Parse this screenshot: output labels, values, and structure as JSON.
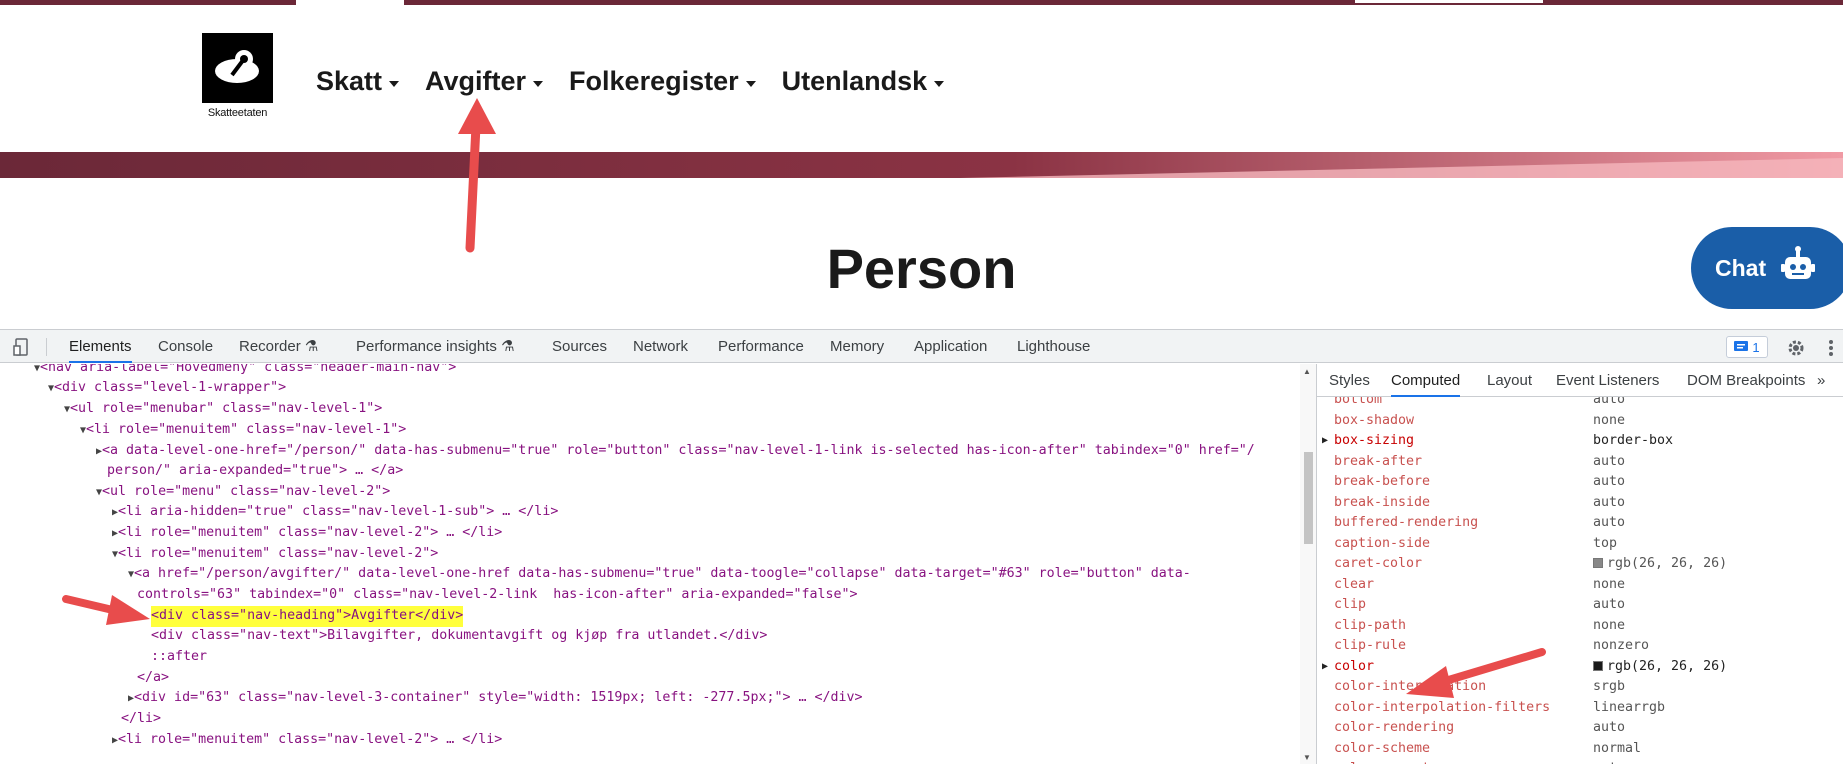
{
  "site": {
    "logo_text": "Skatteetaten",
    "nav": [
      "Skatt",
      "Avgifter",
      "Folkeregister",
      "Utenlandsk"
    ],
    "page_title": "Person",
    "chat_label": "Chat",
    "colors": {
      "brand_bar": "#6b2838",
      "chat": "#1a5ea8"
    }
  },
  "devtools": {
    "tabs": [
      "Elements",
      "Console",
      "Recorder",
      "Performance insights",
      "Sources",
      "Network",
      "Performance",
      "Memory",
      "Application",
      "Lighthouse"
    ],
    "active_tab": "Elements",
    "issues_count": "1",
    "side_tabs": [
      "Styles",
      "Computed",
      "Layout",
      "Event Listeners",
      "DOM Breakpoints"
    ],
    "active_side_tab": "Computed",
    "dom_lines": [
      "<nav aria-label=\"Hovedmeny\" class=\"header-main-nav\">",
      "<div class=\"level-1-wrapper\">",
      "<ul role=\"menubar\" class=\"nav-level-1\">",
      "<li role=\"menuitem\" class=\"nav-level-1\">",
      "<a data-level-one-href=\"/person/\" data-has-submenu=\"true\" role=\"button\" class=\"nav-level-1-link is-selected has-icon-after\" tabindex=\"0\" href=\"/",
      "person/\" aria-expanded=\"true\"> … </a>",
      "<ul role=\"menu\" class=\"nav-level-2\">",
      "<li aria-hidden=\"true\" class=\"nav-level-1-sub\"> … </li>",
      "<li role=\"menuitem\" class=\"nav-level-2\"> … </li>",
      "<li role=\"menuitem\" class=\"nav-level-2\">",
      "<a href=\"/person/avgifter/\" data-level-one-href data-has-submenu=\"true\" data-toogle=\"collapse\" data-target=\"#63\" role=\"button\" data-",
      "controls=\"63\" tabindex=\"0\" class=\"nav-level-2-link  has-icon-after\" aria-expanded=\"false\">",
      "<div class=\"nav-heading\">Avgifter</div>",
      "<div class=\"nav-text\">Bilavgifter, dokumentavgift og kjøp fra utlandet.</div>",
      "::after",
      "</a>",
      "<div id=\"63\" class=\"nav-level-3-container\" style=\"width: 1519px; left: -277.5px;\"> … </div>",
      "</li>",
      "<li role=\"menuitem\" class=\"nav-level-2\"> … </li>"
    ],
    "computed": [
      {
        "name": "bottom",
        "value": "auto"
      },
      {
        "name": "box-shadow",
        "value": "none"
      },
      {
        "name": "box-sizing",
        "value": "border-box"
      },
      {
        "name": "break-after",
        "value": "auto"
      },
      {
        "name": "break-before",
        "value": "auto"
      },
      {
        "name": "break-inside",
        "value": "auto"
      },
      {
        "name": "buffered-rendering",
        "value": "auto"
      },
      {
        "name": "caption-side",
        "value": "top"
      },
      {
        "name": "caret-color",
        "value": "rgb(26, 26, 26)"
      },
      {
        "name": "clear",
        "value": "none"
      },
      {
        "name": "clip",
        "value": "auto"
      },
      {
        "name": "clip-path",
        "value": "none"
      },
      {
        "name": "clip-rule",
        "value": "nonzero"
      },
      {
        "name": "color",
        "value": "rgb(26, 26, 26)"
      },
      {
        "name": "color-interpolation",
        "value": "srgb"
      },
      {
        "name": "color-interpolation-filters",
        "value": "linearrgb"
      },
      {
        "name": "color-rendering",
        "value": "auto"
      },
      {
        "name": "color-scheme",
        "value": "normal"
      },
      {
        "name": "column-count",
        "value": "auto"
      }
    ]
  }
}
